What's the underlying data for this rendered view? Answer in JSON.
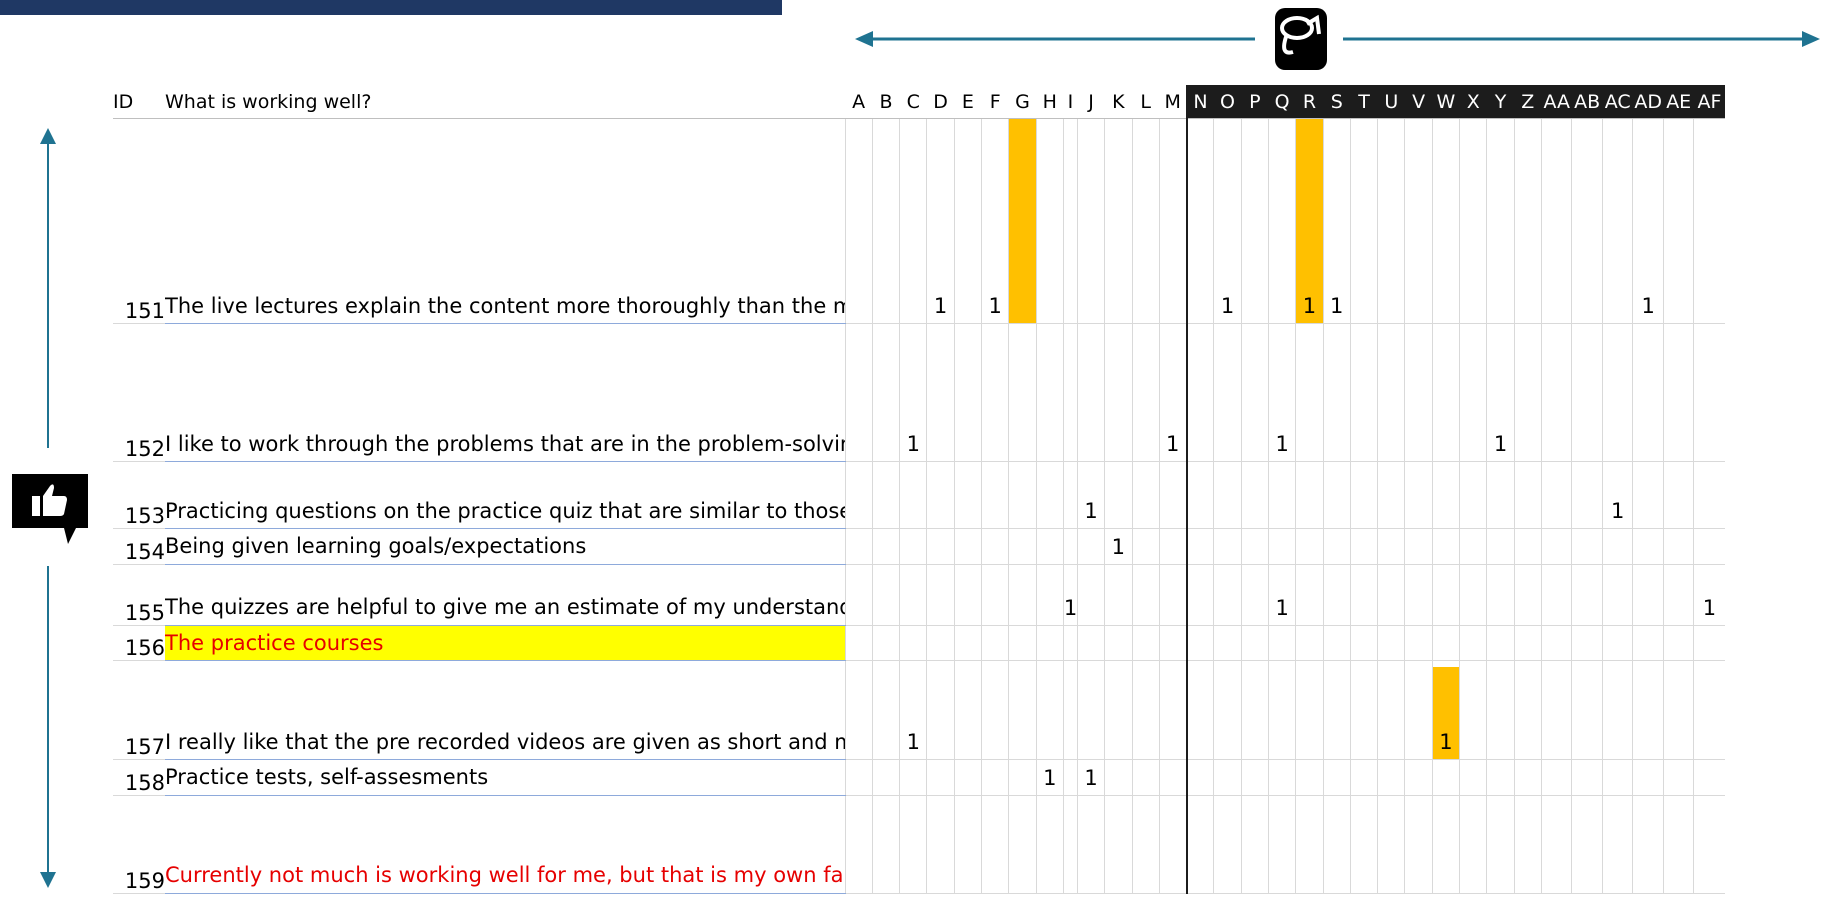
{
  "header": {
    "id_label": "ID",
    "question": "What is working well?"
  },
  "columns": [
    "A",
    "B",
    "C",
    "D",
    "E",
    "F",
    "G",
    "H",
    "I",
    "J",
    "K",
    "L",
    "M",
    "N",
    "O",
    "P",
    "Q",
    "R",
    "S",
    "T",
    "U",
    "V",
    "W",
    "X",
    "Y",
    "Z",
    "AA",
    "AB",
    "AC",
    "AD",
    "AE",
    "AF"
  ],
  "rows": [
    {
      "id": "151",
      "text": "The live lectures explain the content more thoroughly than the modules. The professor answers the Q&A during the lecture. There is a lot of practice material. The weekly checklists are helpful. I like that the quizzes and labs are unlimited time so we can work on them throughout the week. The professor help desk is very helpful.",
      "style": "normal",
      "marks": {
        "D": "1",
        "F": "1",
        "O": "1",
        "R": "1",
        "S": "1",
        "AD": "1"
      },
      "highlight": [
        "G",
        "R"
      ]
    },
    {
      "id": "152",
      "text": "I like to work through the problems that are in the problem-solving modules. I also like that the lectures are pre-recorded so that I can watch them as many times as needed to understand a concept.",
      "style": "normal",
      "marks": {
        "C": "1",
        "M": "1",
        "Q": "1",
        "Y": "1"
      },
      "highlight": []
    },
    {
      "id": "153",
      "text": "Practicing questions on the practice quiz that are similar to those on the actual quiz and tests.",
      "style": "normal",
      "marks": {
        "J": "1",
        "AC": "1"
      },
      "highlight": []
    },
    {
      "id": "154",
      "text": "Being given learning goals/expectations",
      "style": "normal",
      "marks": {
        "K": "1"
      },
      "highlight": []
    },
    {
      "id": "155",
      "text": "The quizzes are helpful to give me an estimate of my understanding for a particular topic.",
      "style": "normal",
      "marks": {
        "I": "1",
        "Q": "1",
        "AF": "1"
      },
      "highlight": []
    },
    {
      "id": "156",
      "text": "The practice courses",
      "style": "red-yellow",
      "marks": {},
      "highlight": []
    },
    {
      "id": "157",
      "text": "I really like that the pre recorded videos are given as short and manageable amounts of information (rather than 1 long video, 4 smaller videos).",
      "style": "normal",
      "marks": {
        "C": "1",
        "W": "1"
      },
      "highlight": [
        "W"
      ],
      "highlight_partial": "W"
    },
    {
      "id": "158",
      "text": "Practice tests, self-assesments",
      "style": "normal",
      "marks": {
        "H": "1",
        "J": "1"
      },
      "highlight": []
    },
    {
      "id": "159",
      "text": "Currently not much is working well for me, but that is my own fault because I am not putting enough effort into the class.",
      "style": "red",
      "marks": {},
      "highlight": []
    }
  ],
  "icons": {
    "top_arrow": "horizontal-double-arrow-icon",
    "paint": "paint-bucket-icon",
    "side_arrow": "vertical-double-arrow-icon",
    "thumb": "thumbs-up-icon"
  },
  "colors": {
    "top_bar": "#1f3864",
    "arrow": "#1f7391",
    "dark_header": "#1c1c1c",
    "highlight": "#ffc000",
    "yellow_fill": "#ffff00",
    "red_text": "#e60000"
  }
}
